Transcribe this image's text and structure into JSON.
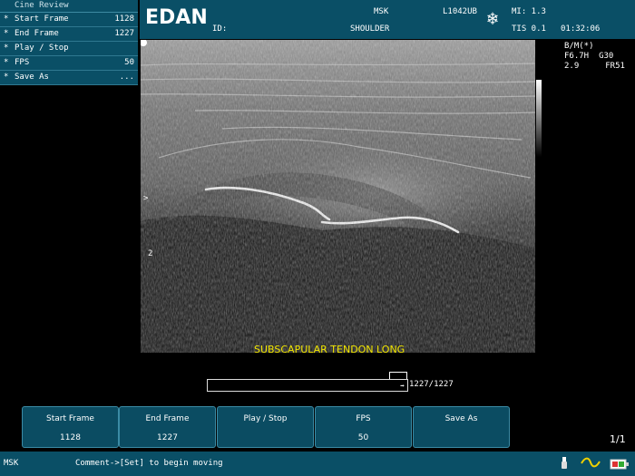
{
  "header": {
    "brand": "EDAN",
    "id_label": "ID:",
    "exam": "MSK",
    "region": "SHOULDER",
    "probe": "L1042UB",
    "mi": "MI: 1.3",
    "tis": "TIS 0.1",
    "time": "01:32:06"
  },
  "cine": {
    "title": "Cine Review",
    "items": [
      {
        "label": "Start Frame",
        "value": "1128"
      },
      {
        "label": "End Frame",
        "value": "1227"
      },
      {
        "label": "Play / Stop",
        "value": ""
      },
      {
        "label": "FPS",
        "value": "50"
      },
      {
        "label": "Save As",
        "value": "..."
      }
    ]
  },
  "params": {
    "mode": "B/M(*)",
    "freq": "F6.7H",
    "gain": "G30",
    "depth": "2.9",
    "frame_rate": "FR51"
  },
  "depth_marks": [
    ">",
    "2"
  ],
  "caption": "SUBSCAPULAR TENDON LONG",
  "progress": {
    "text": "1227/1227",
    "fraction": 1.0
  },
  "softkeys": [
    {
      "title": "Start Frame",
      "value": "1128"
    },
    {
      "title": "End Frame",
      "value": "1227"
    },
    {
      "title": "Play / Stop",
      "value": ""
    },
    {
      "title": "FPS",
      "value": "50"
    },
    {
      "title": "Save As",
      "value": ""
    }
  ],
  "page_indicator": "1/1",
  "status": {
    "mode": "MSK",
    "message": "Comment->[Set] to begin moving"
  },
  "icons": [
    "freeze-snowflake-icon",
    "usb-icon",
    "waveform-icon",
    "battery-icon"
  ]
}
